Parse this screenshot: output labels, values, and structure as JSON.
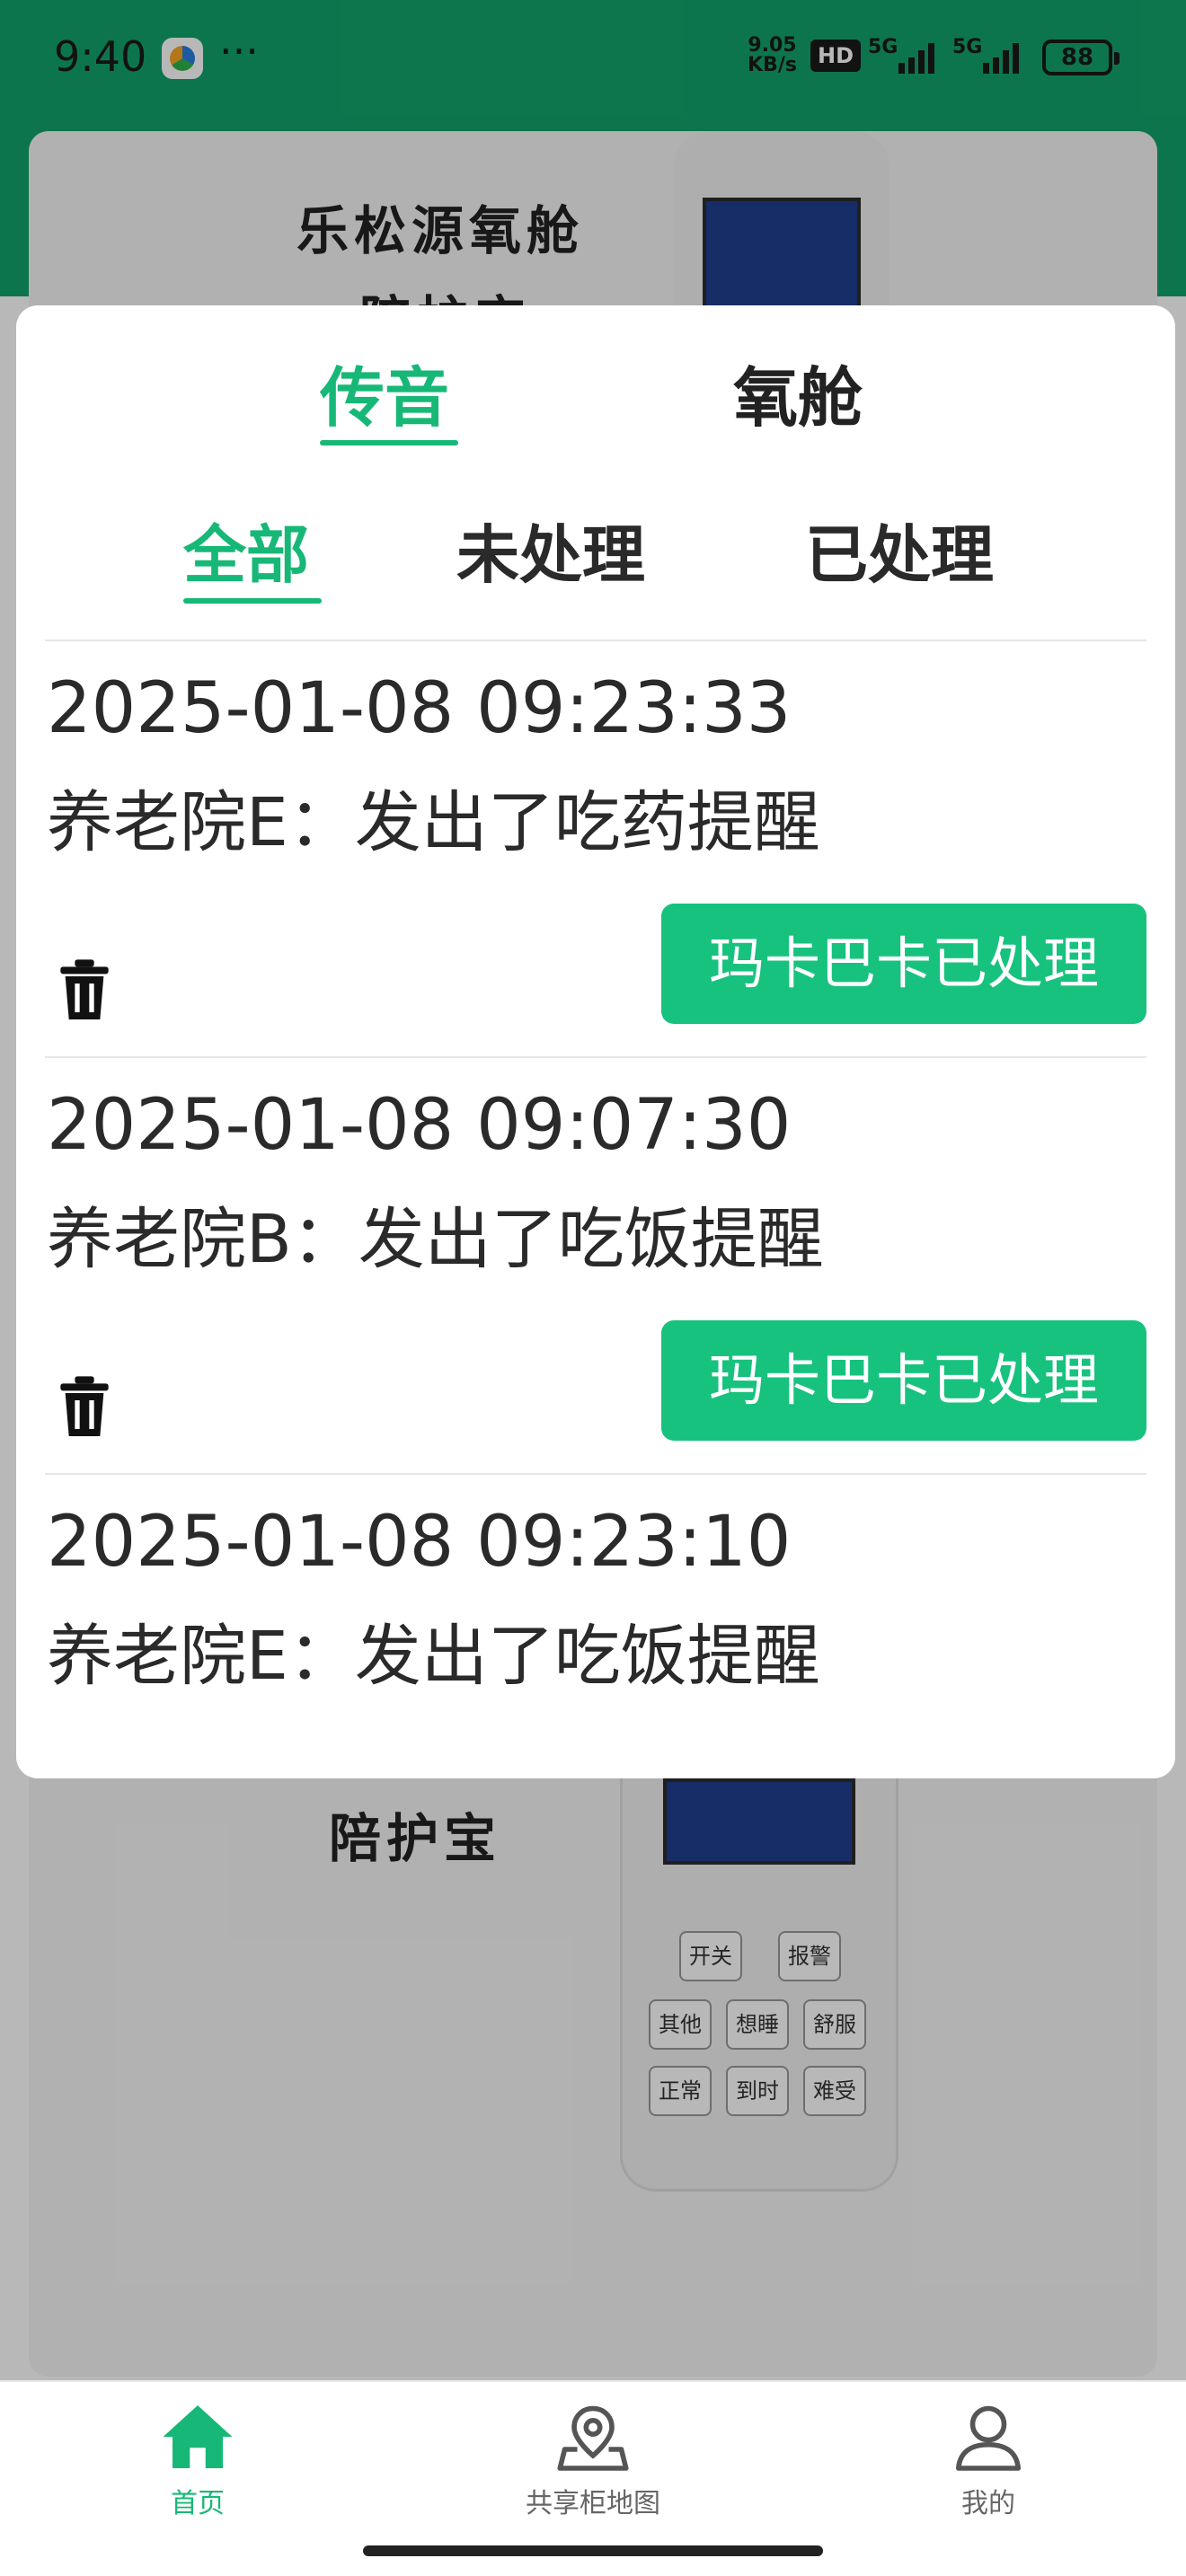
{
  "status_bar": {
    "time": "9:40",
    "dots": "···",
    "speed_value": "9.05",
    "speed_unit": "KB/s",
    "hd": "HD",
    "signal1": "5G",
    "signal2": "5G",
    "battery": "88"
  },
  "background": {
    "product_title_line1": "乐松源氧舱",
    "product_title_line2": "陪护宝",
    "product_subtitle": "陪护宝",
    "device_buttons": [
      "开关",
      "报警",
      "其他",
      "想睡",
      "舒服",
      "正常",
      "到时",
      "难受"
    ]
  },
  "modal": {
    "tabs": [
      {
        "label": "传音",
        "active": true
      },
      {
        "label": "氧舱",
        "active": false
      }
    ],
    "subtabs": [
      {
        "label": "全部",
        "active": true
      },
      {
        "label": "未处理",
        "active": false
      },
      {
        "label": "已处理",
        "active": false
      }
    ],
    "records": [
      {
        "time": "2025-01-08 09:23:33",
        "message": "养老院E：发出了吃药提醒",
        "action": "玛卡巴卡已处理"
      },
      {
        "time": "2025-01-08 09:07:30",
        "message": "养老院B：发出了吃饭提醒",
        "action": "玛卡巴卡已处理"
      },
      {
        "time": "2025-01-08 09:23:10",
        "message": "养老院E：发出了吃饭提醒"
      }
    ]
  },
  "bottom_nav": [
    {
      "label": "首页",
      "icon": "home-icon",
      "active": true
    },
    {
      "label": "共享柜地图",
      "icon": "map-pin-icon",
      "active": false
    },
    {
      "label": "我的",
      "icon": "user-icon",
      "active": false
    }
  ],
  "colors": {
    "brand_green": "#17b877",
    "header_green": "#12a36b",
    "button_green": "#17c27e"
  }
}
